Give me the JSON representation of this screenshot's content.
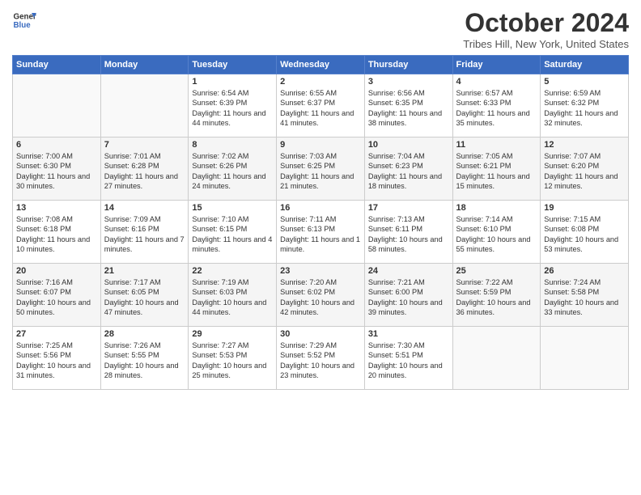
{
  "header": {
    "logo_line1": "General",
    "logo_line2": "Blue",
    "month_title": "October 2024",
    "location": "Tribes Hill, New York, United States"
  },
  "weekdays": [
    "Sunday",
    "Monday",
    "Tuesday",
    "Wednesday",
    "Thursday",
    "Friday",
    "Saturday"
  ],
  "weeks": [
    [
      {
        "day": "",
        "info": ""
      },
      {
        "day": "",
        "info": ""
      },
      {
        "day": "1",
        "info": "Sunrise: 6:54 AM\nSunset: 6:39 PM\nDaylight: 11 hours and 44 minutes."
      },
      {
        "day": "2",
        "info": "Sunrise: 6:55 AM\nSunset: 6:37 PM\nDaylight: 11 hours and 41 minutes."
      },
      {
        "day": "3",
        "info": "Sunrise: 6:56 AM\nSunset: 6:35 PM\nDaylight: 11 hours and 38 minutes."
      },
      {
        "day": "4",
        "info": "Sunrise: 6:57 AM\nSunset: 6:33 PM\nDaylight: 11 hours and 35 minutes."
      },
      {
        "day": "5",
        "info": "Sunrise: 6:59 AM\nSunset: 6:32 PM\nDaylight: 11 hours and 32 minutes."
      }
    ],
    [
      {
        "day": "6",
        "info": "Sunrise: 7:00 AM\nSunset: 6:30 PM\nDaylight: 11 hours and 30 minutes."
      },
      {
        "day": "7",
        "info": "Sunrise: 7:01 AM\nSunset: 6:28 PM\nDaylight: 11 hours and 27 minutes."
      },
      {
        "day": "8",
        "info": "Sunrise: 7:02 AM\nSunset: 6:26 PM\nDaylight: 11 hours and 24 minutes."
      },
      {
        "day": "9",
        "info": "Sunrise: 7:03 AM\nSunset: 6:25 PM\nDaylight: 11 hours and 21 minutes."
      },
      {
        "day": "10",
        "info": "Sunrise: 7:04 AM\nSunset: 6:23 PM\nDaylight: 11 hours and 18 minutes."
      },
      {
        "day": "11",
        "info": "Sunrise: 7:05 AM\nSunset: 6:21 PM\nDaylight: 11 hours and 15 minutes."
      },
      {
        "day": "12",
        "info": "Sunrise: 7:07 AM\nSunset: 6:20 PM\nDaylight: 11 hours and 12 minutes."
      }
    ],
    [
      {
        "day": "13",
        "info": "Sunrise: 7:08 AM\nSunset: 6:18 PM\nDaylight: 11 hours and 10 minutes."
      },
      {
        "day": "14",
        "info": "Sunrise: 7:09 AM\nSunset: 6:16 PM\nDaylight: 11 hours and 7 minutes."
      },
      {
        "day": "15",
        "info": "Sunrise: 7:10 AM\nSunset: 6:15 PM\nDaylight: 11 hours and 4 minutes."
      },
      {
        "day": "16",
        "info": "Sunrise: 7:11 AM\nSunset: 6:13 PM\nDaylight: 11 hours and 1 minute."
      },
      {
        "day": "17",
        "info": "Sunrise: 7:13 AM\nSunset: 6:11 PM\nDaylight: 10 hours and 58 minutes."
      },
      {
        "day": "18",
        "info": "Sunrise: 7:14 AM\nSunset: 6:10 PM\nDaylight: 10 hours and 55 minutes."
      },
      {
        "day": "19",
        "info": "Sunrise: 7:15 AM\nSunset: 6:08 PM\nDaylight: 10 hours and 53 minutes."
      }
    ],
    [
      {
        "day": "20",
        "info": "Sunrise: 7:16 AM\nSunset: 6:07 PM\nDaylight: 10 hours and 50 minutes."
      },
      {
        "day": "21",
        "info": "Sunrise: 7:17 AM\nSunset: 6:05 PM\nDaylight: 10 hours and 47 minutes."
      },
      {
        "day": "22",
        "info": "Sunrise: 7:19 AM\nSunset: 6:03 PM\nDaylight: 10 hours and 44 minutes."
      },
      {
        "day": "23",
        "info": "Sunrise: 7:20 AM\nSunset: 6:02 PM\nDaylight: 10 hours and 42 minutes."
      },
      {
        "day": "24",
        "info": "Sunrise: 7:21 AM\nSunset: 6:00 PM\nDaylight: 10 hours and 39 minutes."
      },
      {
        "day": "25",
        "info": "Sunrise: 7:22 AM\nSunset: 5:59 PM\nDaylight: 10 hours and 36 minutes."
      },
      {
        "day": "26",
        "info": "Sunrise: 7:24 AM\nSunset: 5:58 PM\nDaylight: 10 hours and 33 minutes."
      }
    ],
    [
      {
        "day": "27",
        "info": "Sunrise: 7:25 AM\nSunset: 5:56 PM\nDaylight: 10 hours and 31 minutes."
      },
      {
        "day": "28",
        "info": "Sunrise: 7:26 AM\nSunset: 5:55 PM\nDaylight: 10 hours and 28 minutes."
      },
      {
        "day": "29",
        "info": "Sunrise: 7:27 AM\nSunset: 5:53 PM\nDaylight: 10 hours and 25 minutes."
      },
      {
        "day": "30",
        "info": "Sunrise: 7:29 AM\nSunset: 5:52 PM\nDaylight: 10 hours and 23 minutes."
      },
      {
        "day": "31",
        "info": "Sunrise: 7:30 AM\nSunset: 5:51 PM\nDaylight: 10 hours and 20 minutes."
      },
      {
        "day": "",
        "info": ""
      },
      {
        "day": "",
        "info": ""
      }
    ]
  ]
}
